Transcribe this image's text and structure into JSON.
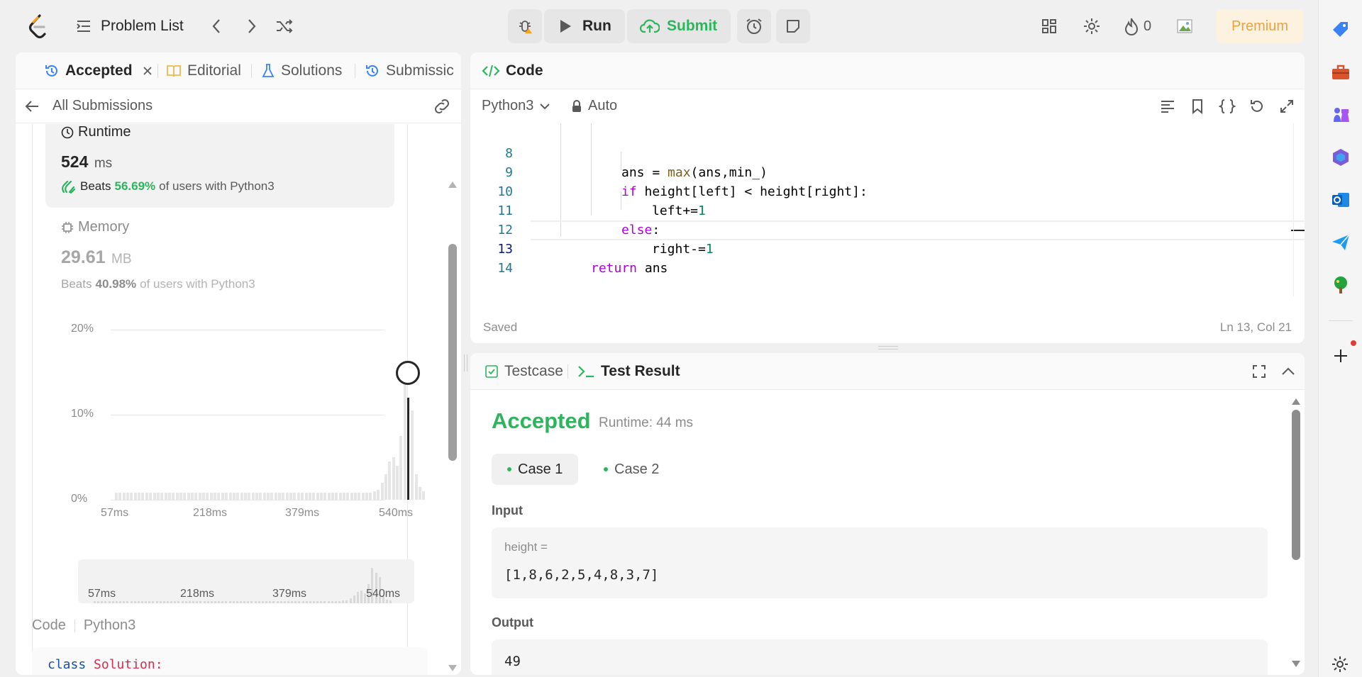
{
  "topbar": {
    "problem_list": "Problem List",
    "run": "Run",
    "submit": "Submit",
    "streak": "0",
    "premium": "Premium"
  },
  "left": {
    "tabs": [
      "Accepted",
      "Editorial",
      "Solutions",
      "Submissic"
    ],
    "back_label": "All Submissions",
    "runtime": {
      "label": "Runtime",
      "value": "524",
      "unit": "ms",
      "beats_prefix": "Beats",
      "beats_pct": "56.69%",
      "beats_suffix": "of users with Python3"
    },
    "memory": {
      "label": "Memory",
      "value": "29.61",
      "unit": "MB",
      "beats_prefix": "Beats",
      "beats_pct": "40.98%",
      "beats_suffix": "of users with Python3"
    },
    "code_header": {
      "label": "Code",
      "lang": "Python3"
    },
    "code_first": {
      "kw": "class",
      "name": "Solution:"
    }
  },
  "chart_data": {
    "type": "bar",
    "ylabel": "",
    "xlabel": "",
    "yticks": [
      "20%",
      "10%",
      "0%"
    ],
    "ylim": [
      0,
      20
    ],
    "xticks": [
      "57ms",
      "218ms",
      "379ms",
      "540ms"
    ],
    "highlighted_bar": 524,
    "values": [
      0.8,
      0.8,
      0.8,
      0.8,
      0.8,
      0.8,
      0.8,
      0.8,
      0.8,
      0.8,
      0.8,
      0.8,
      0.8,
      0.8,
      0.8,
      0.8,
      0.8,
      0.8,
      0.8,
      0.8,
      0.8,
      0.8,
      0.8,
      0.8,
      0.8,
      0.8,
      0.8,
      0.8,
      0.8,
      0.8,
      0.8,
      0.8,
      0.8,
      0.8,
      0.8,
      0.8,
      0.8,
      0.8,
      0.8,
      0.8,
      0.8,
      0.8,
      0.8,
      0.8,
      0.8,
      0.8,
      0.8,
      0.8,
      0.8,
      0.8,
      0.8,
      0.8,
      0.8,
      0.8,
      0.8,
      0.8,
      0.8,
      0.8,
      0.8,
      0.8,
      0.8,
      0.8,
      0.8,
      0.8,
      0.8,
      0.8,
      0.8,
      0.8,
      1.0,
      1.2,
      2.0,
      3.0,
      4.5,
      5.0,
      4.0,
      7.5,
      14.0,
      12.0,
      10.5,
      3.0,
      1.5,
      1.0
    ],
    "highlight_index": 77
  },
  "editor": {
    "tab_label": "Code",
    "lang": "Python3",
    "mode": "Auto",
    "status_left": "Saved",
    "status_right": "Ln 13, Col 21",
    "lines": [
      {
        "n": "8"
      },
      {
        "n": "9"
      },
      {
        "n": "10"
      },
      {
        "n": "11"
      },
      {
        "n": "12"
      },
      {
        "n": "13"
      },
      {
        "n": "14"
      }
    ],
    "code": {
      "l8a": "ans = ",
      "l8fn": "max",
      "l8b": "(ans,min_)",
      "l9kw": "if",
      "l9b": " height[left] < height[right]:",
      "l10a": "left+=",
      "l10n": "1",
      "l11kw": "else",
      "l11b": ":",
      "l12a": "right-=",
      "l12n": "1",
      "l13kw": "return",
      "l13b": " ans"
    }
  },
  "result": {
    "tab_testcase": "Testcase",
    "tab_result": "Test Result",
    "status": "Accepted",
    "runtime": "Runtime: 44 ms",
    "cases": [
      "Case 1",
      "Case 2"
    ],
    "input_label": "Input",
    "input_var": "height =",
    "input_value": "[1,8,6,2,5,4,8,3,7]",
    "output_label": "Output",
    "output_value": "49"
  },
  "colors": {
    "accent_green": "#2db55d",
    "premium_bg": "#fdf1e0",
    "premium_fg": "#e8a33d"
  }
}
